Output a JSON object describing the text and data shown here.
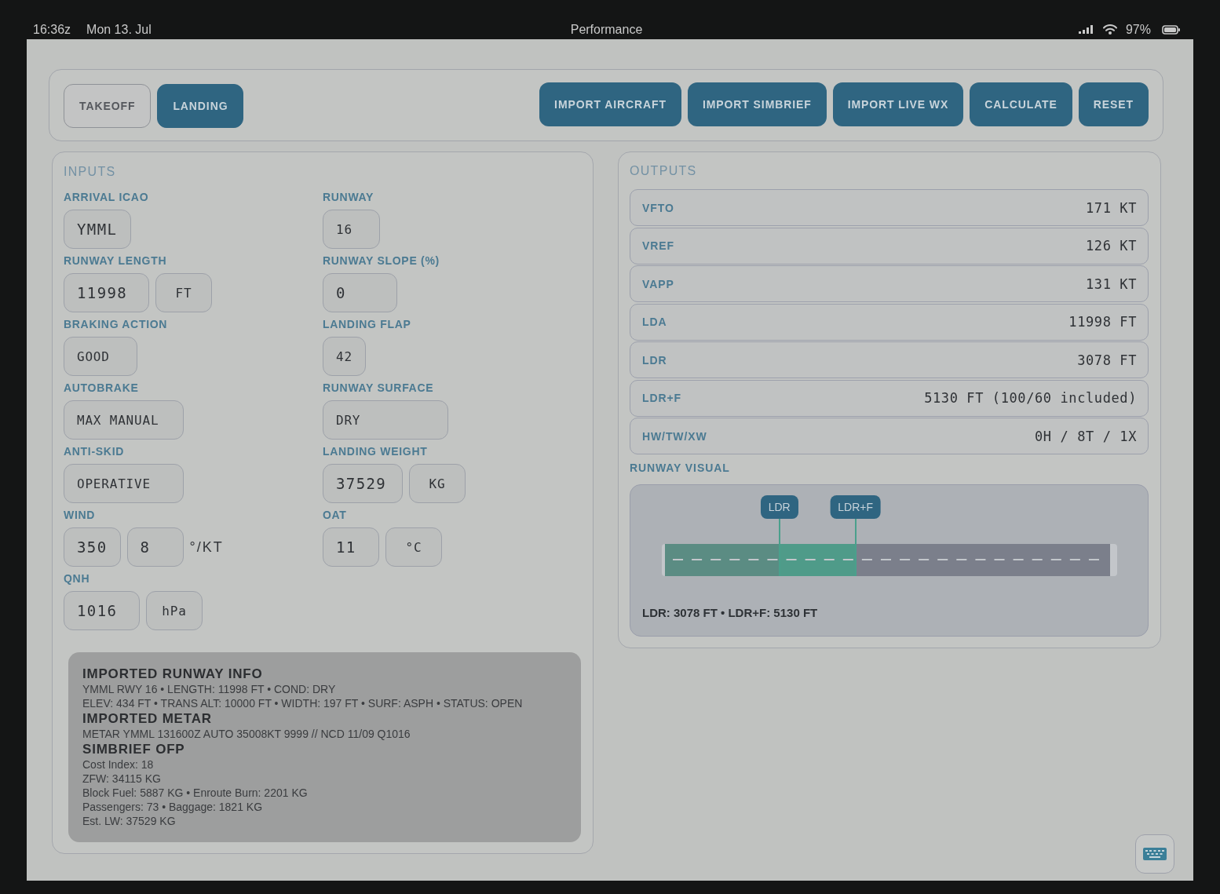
{
  "status_bar": {
    "time": "16:36z",
    "date": "Mon 13. Jul",
    "title": "Performance",
    "battery": "97%"
  },
  "mode_tabs": [
    {
      "label": "TAKEOFF",
      "selected": false
    },
    {
      "label": "LANDING",
      "selected": true
    }
  ],
  "actions": [
    "IMPORT AIRCRAFT",
    "IMPORT SIMBRIEF",
    "IMPORT LIVE WX",
    "CALCULATE",
    "RESET"
  ],
  "inputs": {
    "title": "INPUTS",
    "fields": [
      {
        "label": "ARRIVAL ICAO",
        "boxes": [
          {
            "text": "YMML",
            "kind": "input"
          }
        ]
      },
      {
        "label": "RUNWAY",
        "boxes": [
          {
            "text": "16",
            "kind": "select"
          }
        ]
      },
      {
        "label": "RUNWAY LENGTH",
        "boxes": [
          {
            "text": "11998",
            "kind": "input"
          },
          {
            "text": "FT",
            "kind": "unit"
          }
        ]
      },
      {
        "label": "RUNWAY SLOPE (%)",
        "boxes": [
          {
            "text": "0",
            "kind": "input"
          }
        ]
      },
      {
        "label": "BRAKING ACTION",
        "boxes": [
          {
            "text": "GOOD",
            "kind": "select"
          }
        ]
      },
      {
        "label": "LANDING FLAP",
        "boxes": [
          {
            "text": "42",
            "kind": "select"
          }
        ]
      },
      {
        "label": "AUTOBRAKE",
        "boxes": [
          {
            "text": "MAX MANUAL",
            "kind": "select"
          }
        ]
      },
      {
        "label": "RUNWAY SURFACE",
        "boxes": [
          {
            "text": "DRY",
            "kind": "select"
          }
        ]
      },
      {
        "label": "ANTI-SKID",
        "boxes": [
          {
            "text": "OPERATIVE",
            "kind": "select"
          }
        ]
      },
      {
        "label": "LANDING WEIGHT",
        "boxes": [
          {
            "text": "37529",
            "kind": "input"
          },
          {
            "text": "KG",
            "kind": "unit"
          }
        ]
      },
      {
        "label": "WIND",
        "boxes": [
          {
            "text": "350",
            "kind": "input"
          },
          {
            "text": "8",
            "kind": "input"
          }
        ],
        "suffix": "°/KT"
      },
      {
        "label": "OAT",
        "boxes": [
          {
            "text": "11",
            "kind": "input"
          },
          {
            "text": "°C",
            "kind": "unit"
          }
        ]
      },
      {
        "label": "QNH",
        "boxes": [
          {
            "text": "1016",
            "kind": "input"
          },
          {
            "text": "hPa",
            "kind": "unit"
          }
        ]
      }
    ]
  },
  "imported_info": [
    {
      "heading": "IMPORTED RUNWAY INFO",
      "lines": [
        "YMML RWY 16 • LENGTH: 11998 FT • COND: DRY",
        "ELEV: 434 FT • TRANS ALT: 10000 FT • WIDTH: 197 FT • SURF: ASPH • STATUS: OPEN"
      ]
    },
    {
      "heading": "IMPORTED METAR",
      "lines": [
        "METAR YMML 131600Z AUTO 35008KT 9999 // NCD 11/09 Q1016"
      ]
    },
    {
      "heading": "SIMBRIEF OFP",
      "lines": [
        "Cost Index: 18",
        "ZFW: 34115 KG",
        "Block Fuel: 5887 KG • Enroute Burn: 2201 KG",
        "Passengers: 73 • Baggage: 1821 KG",
        "Est. LW: 37529 KG"
      ]
    }
  ],
  "outputs": {
    "title": "OUTPUTS",
    "rows": [
      {
        "label": "VFTO",
        "value": "171 KT"
      },
      {
        "label": "VREF",
        "value": "126 KT"
      },
      {
        "label": "VAPP",
        "value": "131 KT"
      },
      {
        "label": "LDA",
        "value": "11998 FT"
      },
      {
        "label": "LDR",
        "value": "3078 FT"
      },
      {
        "label": "LDR+F",
        "value": "5130 FT (100/60 included)"
      },
      {
        "label": "HW/TW/XW",
        "value": "0H / 8T / 1X"
      }
    ]
  },
  "runway_visual": {
    "title": "RUNWAY VISUAL",
    "markers": [
      {
        "label": "LDR",
        "level": 0.257
      },
      {
        "label": "LDR+F",
        "level": 0.428
      }
    ],
    "caption": "LDR: 3078 FT • LDR+F: 5130 FT"
  }
}
